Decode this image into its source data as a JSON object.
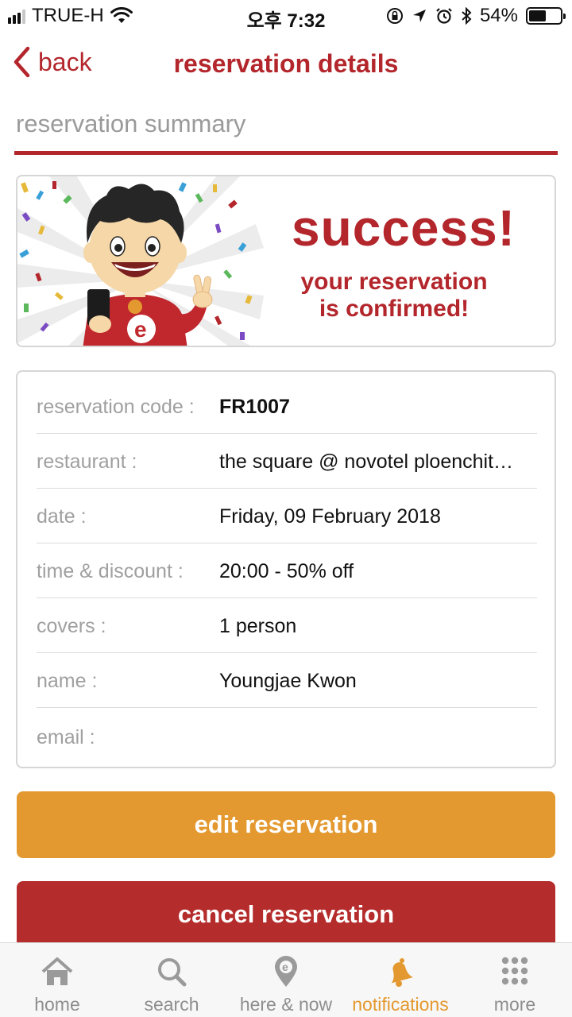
{
  "status_bar": {
    "carrier": "TRUE-H",
    "time": "오후 7:32",
    "battery_percent": "54%",
    "battery_level": 0.54,
    "signal_bars": 4,
    "icons": [
      "wifi-icon",
      "orientation-lock-icon",
      "location-arrow-icon",
      "alarm-icon",
      "bluetooth-icon",
      "battery-icon"
    ]
  },
  "header": {
    "back_label": "back",
    "title": "reservation details"
  },
  "section": {
    "title": "reservation summary"
  },
  "banner": {
    "headline": "success!",
    "subline_1": "your reservation",
    "subline_2": "is confirmed!"
  },
  "details": [
    {
      "label": "reservation code :",
      "value": "FR1007"
    },
    {
      "label": "restaurant :",
      "value": "the square @ novotel ploenchit…"
    },
    {
      "label": "date :",
      "value": "Friday, 09 February 2018"
    },
    {
      "label": "time & discount :",
      "value": "20:00 - 50% off"
    },
    {
      "label": "covers :",
      "value": "1 person"
    },
    {
      "label": "name :",
      "value": "Youngjae Kwon"
    },
    {
      "label": "email :",
      "value": ""
    }
  ],
  "buttons": {
    "edit": "edit reservation",
    "cancel": "cancel reservation"
  },
  "tabbar": {
    "active": "notifications",
    "tabs": [
      {
        "id": "home",
        "label": "home",
        "icon": "home-icon"
      },
      {
        "id": "search",
        "label": "search",
        "icon": "search-icon"
      },
      {
        "id": "here_now",
        "label": "here & now",
        "icon": "map-pin-icon"
      },
      {
        "id": "notifications",
        "label": "notifications",
        "icon": "bell-icon"
      },
      {
        "id": "more",
        "label": "more",
        "icon": "grid-dots-icon"
      }
    ]
  },
  "colors": {
    "brand_red": "#b3262c",
    "accent_orange": "#e3992f",
    "label_gray": "#a0a0a0"
  }
}
